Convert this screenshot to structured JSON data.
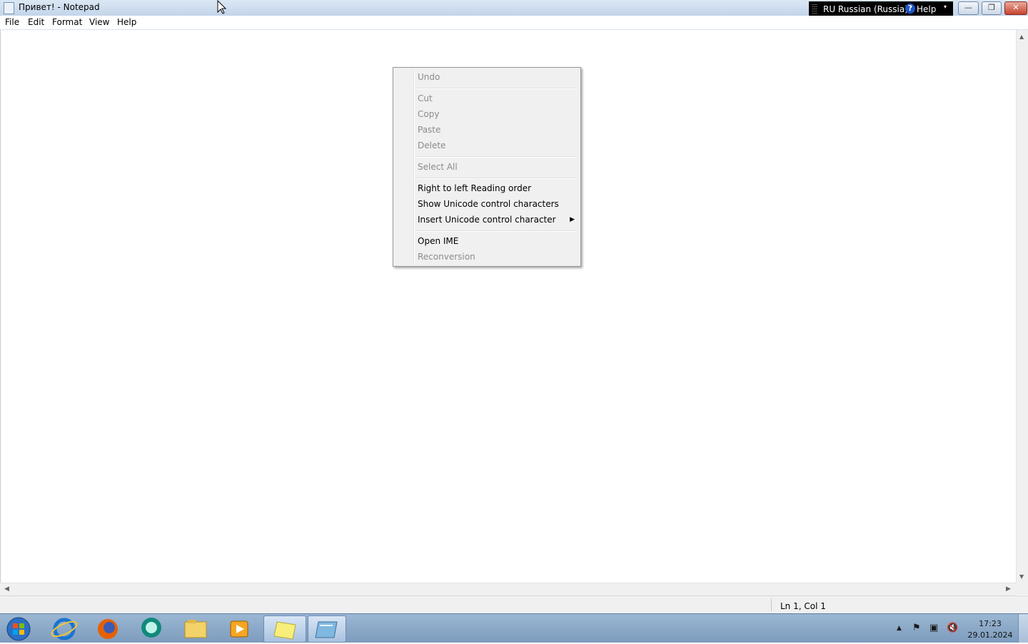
{
  "window": {
    "title": "Привет! - Notepad",
    "controls": {
      "minimize": "—",
      "restore": "❐",
      "close": "✕"
    }
  },
  "language_bar": {
    "language": "RU Russian (Russia)",
    "help_icon": "?",
    "help": "Help",
    "options_icon": "▾"
  },
  "menubar": {
    "items": [
      "File",
      "Edit",
      "Format",
      "View",
      "Help"
    ]
  },
  "context_menu": {
    "items": [
      {
        "label": "Undo",
        "enabled": false
      },
      {
        "label": "Cut",
        "enabled": false
      },
      {
        "label": "Copy",
        "enabled": false
      },
      {
        "label": "Paste",
        "enabled": false
      },
      {
        "label": "Delete",
        "enabled": false
      },
      {
        "label": "Select All",
        "enabled": false
      },
      {
        "label": "Right to left Reading order",
        "enabled": true
      },
      {
        "label": "Show Unicode control characters",
        "enabled": true
      },
      {
        "label": "Insert Unicode control character",
        "enabled": true,
        "submenu_icon": "▶"
      },
      {
        "label": "Open IME",
        "enabled": true
      },
      {
        "label": "Reconversion",
        "enabled": false
      }
    ]
  },
  "scroll_arrows": {
    "up": "▲",
    "down": "▼",
    "left": "◀",
    "right": "▶"
  },
  "statusbar": {
    "position": "Ln 1, Col 1"
  },
  "taskbar": {
    "apps": [
      "start-orb-icon",
      "internet-explorer-icon",
      "firefox-icon",
      "messenger-icon",
      "file-explorer-icon",
      "media-player-icon",
      "sticky-notes-icon",
      "notepad-icon"
    ],
    "tray_icons": {
      "show_hidden": "▲",
      "action_center": "⚑",
      "network": "▣",
      "volume": "🔇"
    },
    "time": "17:23",
    "date": "29.01.2024"
  }
}
